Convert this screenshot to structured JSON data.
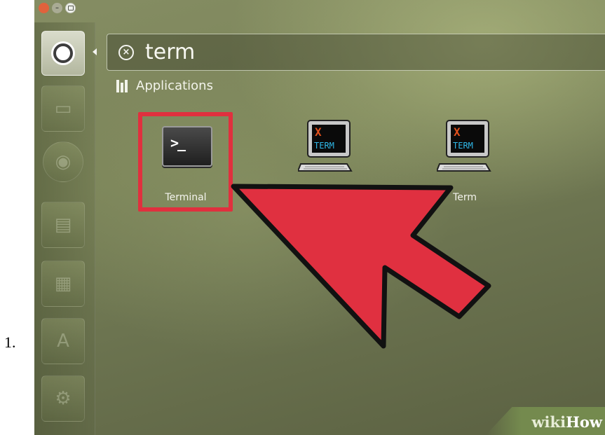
{
  "step": {
    "number": "1."
  },
  "window_controls": {
    "close": "×",
    "minimize": "–",
    "maximize": ""
  },
  "launcher": {
    "items": [
      "dash-home",
      "files",
      "firefox",
      "writer",
      "calc",
      "software",
      "settings"
    ]
  },
  "search": {
    "query": "term"
  },
  "category": {
    "label": "Applications"
  },
  "results": [
    {
      "label": "Terminal",
      "icon": "terminal-icon",
      "highlighted": true
    },
    {
      "label": "",
      "icon": "xterm-icon",
      "highlighted": false
    },
    {
      "label": "Term",
      "icon": "xterm-icon",
      "highlighted": false
    }
  ],
  "xterm_icon": {
    "x_letter": "X",
    "word": "TERM"
  },
  "terminal_icon": {
    "prompt": ">_"
  },
  "watermark": {
    "wiki": "wiki",
    "how": "How"
  },
  "colors": {
    "highlight": "#e0303e",
    "arrow_fill": "#e03040",
    "arrow_outline": "#111111",
    "desktop": "#7b8459"
  }
}
